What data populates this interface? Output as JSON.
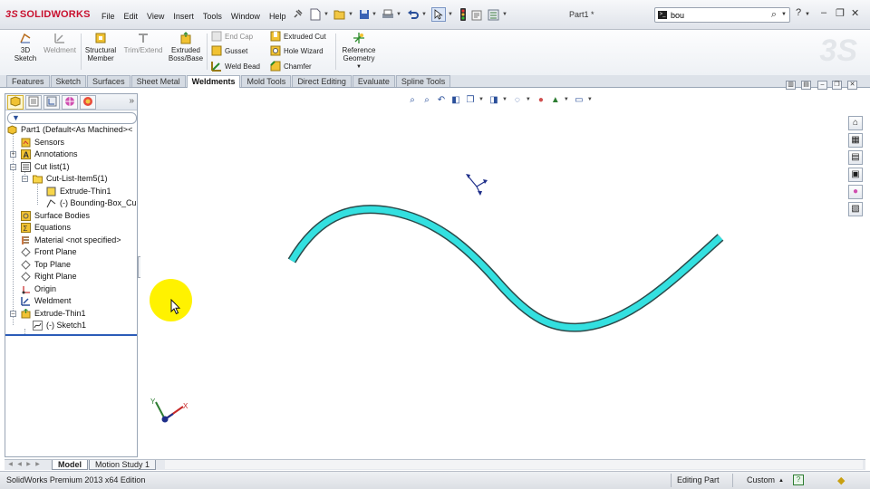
{
  "app": {
    "logo_ds": "3S",
    "logo_name": "SOLIDWORKS",
    "doc_title": "Part1 *",
    "search_value": "bou"
  },
  "menu": [
    "File",
    "Edit",
    "View",
    "Insert",
    "Tools",
    "Window",
    "Help"
  ],
  "command_manager": {
    "sketch_3d": "3D\nSketch",
    "weldment": "Weldment",
    "structural_member": "Structural\nMember",
    "trim_extend": "Trim/Extend",
    "extruded_boss": "Extruded\nBoss/Base",
    "end_cap": "End Cap",
    "gusset": "Gusset",
    "weld_bead": "Weld Bead",
    "extruded_cut": "Extruded Cut",
    "hole_wizard": "Hole Wizard",
    "chamfer": "Chamfer",
    "reference_geometry": "Reference\nGeometry"
  },
  "tabs": [
    "Features",
    "Sketch",
    "Surfaces",
    "Sheet Metal",
    "Weldments",
    "Mold Tools",
    "Direct Editing",
    "Evaluate",
    "Spline Tools"
  ],
  "active_tab": "Weldments",
  "tree": {
    "part": "Part1  (Default<As Machined><",
    "sensors": "Sensors",
    "annotations": "Annotations",
    "cut_list": "Cut list(1)",
    "cut_list_item": "Cut-List-Item5(1)",
    "extrude_thin_child": "Extrude-Thin1",
    "bounding_box": "(-) Bounding-Box_Cu",
    "surface_bodies": "Surface Bodies",
    "equations": "Equations",
    "material": "Material <not specified>",
    "front_plane": "Front Plane",
    "top_plane": "Top Plane",
    "right_plane": "Right Plane",
    "origin": "Origin",
    "weldment": "Weldment",
    "extrude_thin": "Extrude-Thin1",
    "sketch1": "(-) Sketch1"
  },
  "bottom_tabs": [
    "Model",
    "Motion Study 1"
  ],
  "status": {
    "edition": "SolidWorks Premium 2013 x64 Edition",
    "mode": "Editing Part",
    "units": "Custom"
  },
  "colors": {
    "curve_fill": "#33e0e0",
    "curve_edge": "#2b4a4a",
    "cursor_highlight": "#fff200",
    "brand_red": "#c8102e"
  }
}
